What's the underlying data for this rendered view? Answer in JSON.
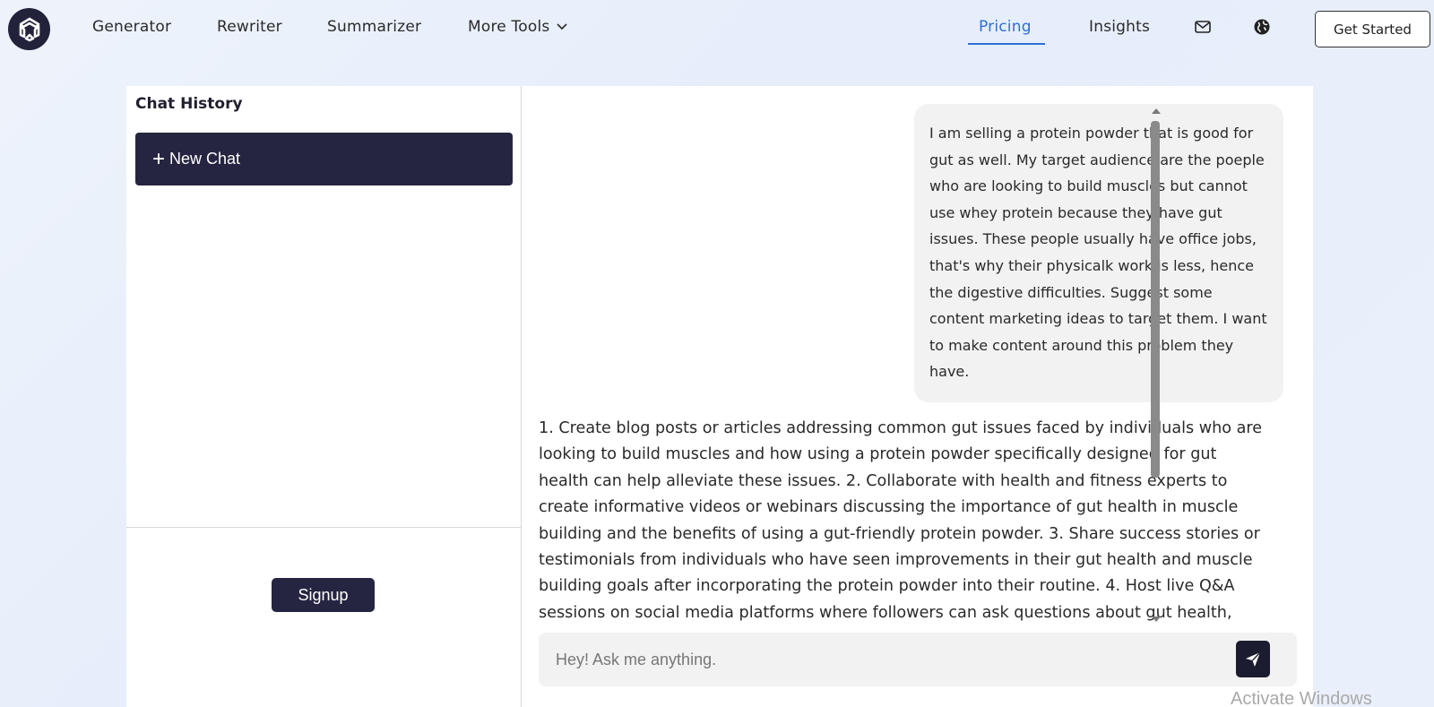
{
  "nav": {
    "links": [
      "Generator",
      "Rewriter",
      "Summarizer"
    ],
    "more_tools": "More Tools",
    "pricing": "Pricing",
    "insights": "Insights",
    "get_started": "Get Started",
    "icons": [
      "logo-icon",
      "chevron-down-icon",
      "mail-icon",
      "globe-icon"
    ]
  },
  "sidebar": {
    "title": "Chat History",
    "new_chat_plus": "+",
    "new_chat": "New Chat",
    "signup": "Signup"
  },
  "chat": {
    "user_message": "I am selling a protein powder that is good for gut as well. My target audience are the poeple who are looking to build muscles but cannot use whey protein because they have gut issues. These people usually have office jobs, that's why their physicalk work is less, hence the digestive difficulties. Suggest some content marketing ideas to target them. I want to make content around this problem they have.",
    "bot_message": "1. Create blog posts or articles addressing common gut issues faced by individuals who are looking to build muscles and how using a protein powder specifically designed for gut health can help alleviate these issues. 2. Collaborate with health and fitness experts to create informative videos or webinars discussing the importance of gut health in muscle building and the benefits of using a gut-friendly protein powder. 3. Share success stories or testimonials from individuals who have seen improvements in their gut health and muscle building goals after incorporating the protein powder into their routine. 4. Host live Q&A sessions on social media platforms where followers can ask questions about gut health,",
    "input_placeholder": "Hey! Ask me anything."
  },
  "watermark": "Activate Windows",
  "colors": {
    "accent": "#2e6fd6",
    "dark_button": "#252541",
    "bubble": "#f2f2f2"
  }
}
